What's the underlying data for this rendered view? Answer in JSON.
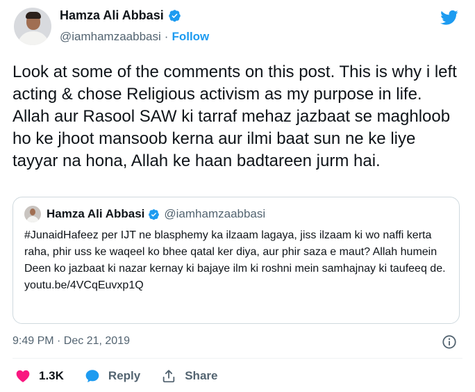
{
  "author": {
    "name": "Hamza Ali Abbasi",
    "handle": "@iamhamzaabbasi",
    "separator": "·",
    "follow_label": "Follow"
  },
  "tweet": {
    "text": "Look at some of the comments on this post. This is why i left acting & chose Religious activism as my purpose in life. Allah aur Rasool SAW ki tarraf mehaz jazbaat se maghloob ho ke jhoot mansoob kerna aur ilmi baat sun ne ke liye tayyar na hona, Allah ke haan badtareen jurm hai.",
    "timestamp": "9:49 PM · Dec 21, 2019"
  },
  "quoted": {
    "name": "Hamza Ali Abbasi",
    "handle": "@iamhamzaabbasi",
    "text": "#JunaidHafeez per IJT ne blasphemy ka ilzaam lagaya, jiss ilzaam ki wo naffi kerta raha, phir uss ke waqeel ko bhee qatal ker diya, aur phir saza e maut? Allah humein Deen ko jazbaat ki nazar kernay ki bajaye ilm ki roshni mein samhajnay ki taufeeq de.",
    "link": "youtu.be/4VCqEuvxp1Q"
  },
  "actions": {
    "like_count": "1.3K",
    "reply_label": "Reply",
    "share_label": "Share"
  },
  "icons": [
    "verified-badge-icon",
    "twitter-bird-icon",
    "info-icon",
    "heart-icon",
    "reply-bubble-icon",
    "share-icon"
  ],
  "colors": {
    "brand_blue": "#1d9bf0",
    "like_pink": "#f91880",
    "secondary_text": "#536471",
    "border": "#cfd9de"
  }
}
